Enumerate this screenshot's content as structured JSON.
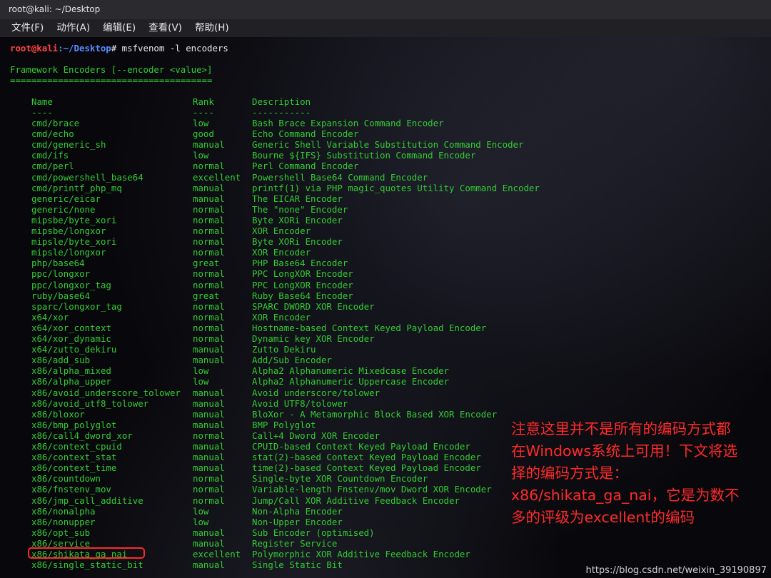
{
  "window": {
    "title": "root@kali: ~/Desktop"
  },
  "menu": [
    {
      "label": "文件(F)"
    },
    {
      "label": "动作(A)"
    },
    {
      "label": "编辑(E)"
    },
    {
      "label": "查看(V)"
    },
    {
      "label": "帮助(H)"
    }
  ],
  "terminal": {
    "prompt_user": "root@kali",
    "prompt_path": ":~/Desktop",
    "prompt_symbol": "#",
    "command": " msfvenom -l encoders",
    "section_title": "Framework Encoders [--encoder <value>]",
    "section_rule": "======================================",
    "headers": {
      "name": "Name",
      "rank": "Rank",
      "description": "Description"
    },
    "dashes": {
      "name": "----",
      "rank": "----",
      "description": "-----------"
    },
    "rows": [
      {
        "name": "cmd/brace",
        "rank": "low",
        "description": "Bash Brace Expansion Command Encoder"
      },
      {
        "name": "cmd/echo",
        "rank": "good",
        "description": "Echo Command Encoder"
      },
      {
        "name": "cmd/generic_sh",
        "rank": "manual",
        "description": "Generic Shell Variable Substitution Command Encoder"
      },
      {
        "name": "cmd/ifs",
        "rank": "low",
        "description": "Bourne ${IFS} Substitution Command Encoder"
      },
      {
        "name": "cmd/perl",
        "rank": "normal",
        "description": "Perl Command Encoder"
      },
      {
        "name": "cmd/powershell_base64",
        "rank": "excellent",
        "description": "Powershell Base64 Command Encoder"
      },
      {
        "name": "cmd/printf_php_mq",
        "rank": "manual",
        "description": "printf(1) via PHP magic_quotes Utility Command Encoder"
      },
      {
        "name": "generic/eicar",
        "rank": "manual",
        "description": "The EICAR Encoder"
      },
      {
        "name": "generic/none",
        "rank": "normal",
        "description": "The \"none\" Encoder"
      },
      {
        "name": "mipsbe/byte_xori",
        "rank": "normal",
        "description": "Byte XORi Encoder"
      },
      {
        "name": "mipsbe/longxor",
        "rank": "normal",
        "description": "XOR Encoder"
      },
      {
        "name": "mipsle/byte_xori",
        "rank": "normal",
        "description": "Byte XORi Encoder"
      },
      {
        "name": "mipsle/longxor",
        "rank": "normal",
        "description": "XOR Encoder"
      },
      {
        "name": "php/base64",
        "rank": "great",
        "description": "PHP Base64 Encoder"
      },
      {
        "name": "ppc/longxor",
        "rank": "normal",
        "description": "PPC LongXOR Encoder"
      },
      {
        "name": "ppc/longxor_tag",
        "rank": "normal",
        "description": "PPC LongXOR Encoder"
      },
      {
        "name": "ruby/base64",
        "rank": "great",
        "description": "Ruby Base64 Encoder"
      },
      {
        "name": "sparc/longxor_tag",
        "rank": "normal",
        "description": "SPARC DWORD XOR Encoder"
      },
      {
        "name": "x64/xor",
        "rank": "normal",
        "description": "XOR Encoder"
      },
      {
        "name": "x64/xor_context",
        "rank": "normal",
        "description": "Hostname-based Context Keyed Payload Encoder"
      },
      {
        "name": "x64/xor_dynamic",
        "rank": "normal",
        "description": "Dynamic key XOR Encoder"
      },
      {
        "name": "x64/zutto_dekiru",
        "rank": "manual",
        "description": "Zutto Dekiru"
      },
      {
        "name": "x86/add_sub",
        "rank": "manual",
        "description": "Add/Sub Encoder"
      },
      {
        "name": "x86/alpha_mixed",
        "rank": "low",
        "description": "Alpha2 Alphanumeric Mixedcase Encoder"
      },
      {
        "name": "x86/alpha_upper",
        "rank": "low",
        "description": "Alpha2 Alphanumeric Uppercase Encoder"
      },
      {
        "name": "x86/avoid_underscore_tolower",
        "rank": "manual",
        "description": "Avoid underscore/tolower"
      },
      {
        "name": "x86/avoid_utf8_tolower",
        "rank": "manual",
        "description": "Avoid UTF8/tolower"
      },
      {
        "name": "x86/bloxor",
        "rank": "manual",
        "description": "BloXor - A Metamorphic Block Based XOR Encoder"
      },
      {
        "name": "x86/bmp_polyglot",
        "rank": "manual",
        "description": "BMP Polyglot"
      },
      {
        "name": "x86/call4_dword_xor",
        "rank": "normal",
        "description": "Call+4 Dword XOR Encoder"
      },
      {
        "name": "x86/context_cpuid",
        "rank": "manual",
        "description": "CPUID-based Context Keyed Payload Encoder"
      },
      {
        "name": "x86/context_stat",
        "rank": "manual",
        "description": "stat(2)-based Context Keyed Payload Encoder"
      },
      {
        "name": "x86/context_time",
        "rank": "manual",
        "description": "time(2)-based Context Keyed Payload Encoder"
      },
      {
        "name": "x86/countdown",
        "rank": "normal",
        "description": "Single-byte XOR Countdown Encoder"
      },
      {
        "name": "x86/fnstenv_mov",
        "rank": "normal",
        "description": "Variable-length Fnstenv/mov Dword XOR Encoder"
      },
      {
        "name": "x86/jmp_call_additive",
        "rank": "normal",
        "description": "Jump/Call XOR Additive Feedback Encoder"
      },
      {
        "name": "x86/nonalpha",
        "rank": "low",
        "description": "Non-Alpha Encoder"
      },
      {
        "name": "x86/nonupper",
        "rank": "low",
        "description": "Non-Upper Encoder"
      },
      {
        "name": "x86/opt_sub",
        "rank": "manual",
        "description": "Sub Encoder (optimised)"
      },
      {
        "name": "x86/service",
        "rank": "manual",
        "description": "Register Service"
      },
      {
        "name": "x86/shikata_ga_nai",
        "rank": "excellent",
        "description": "Polymorphic XOR Additive Feedback Encoder"
      },
      {
        "name": "x86/single_static_bit",
        "rank": "manual",
        "description": "Single Static Bit"
      }
    ]
  },
  "annotation": {
    "text": "注意这里并不是所有的编码方式都\n在Windows系统上可用！下文将选\n择的编码方式是：\nx86/shikata_ga_nai，它是为数不\n多的评级为excellent的编码",
    "color": "#ff2a2a"
  },
  "watermark": "https://blog.csdn.net/weixin_39190897",
  "colors": {
    "terminal_green": "#33cc33",
    "prompt_red": "#ff4444",
    "prompt_blue": "#5a8cff",
    "annotation_red": "#ff2a2a"
  }
}
